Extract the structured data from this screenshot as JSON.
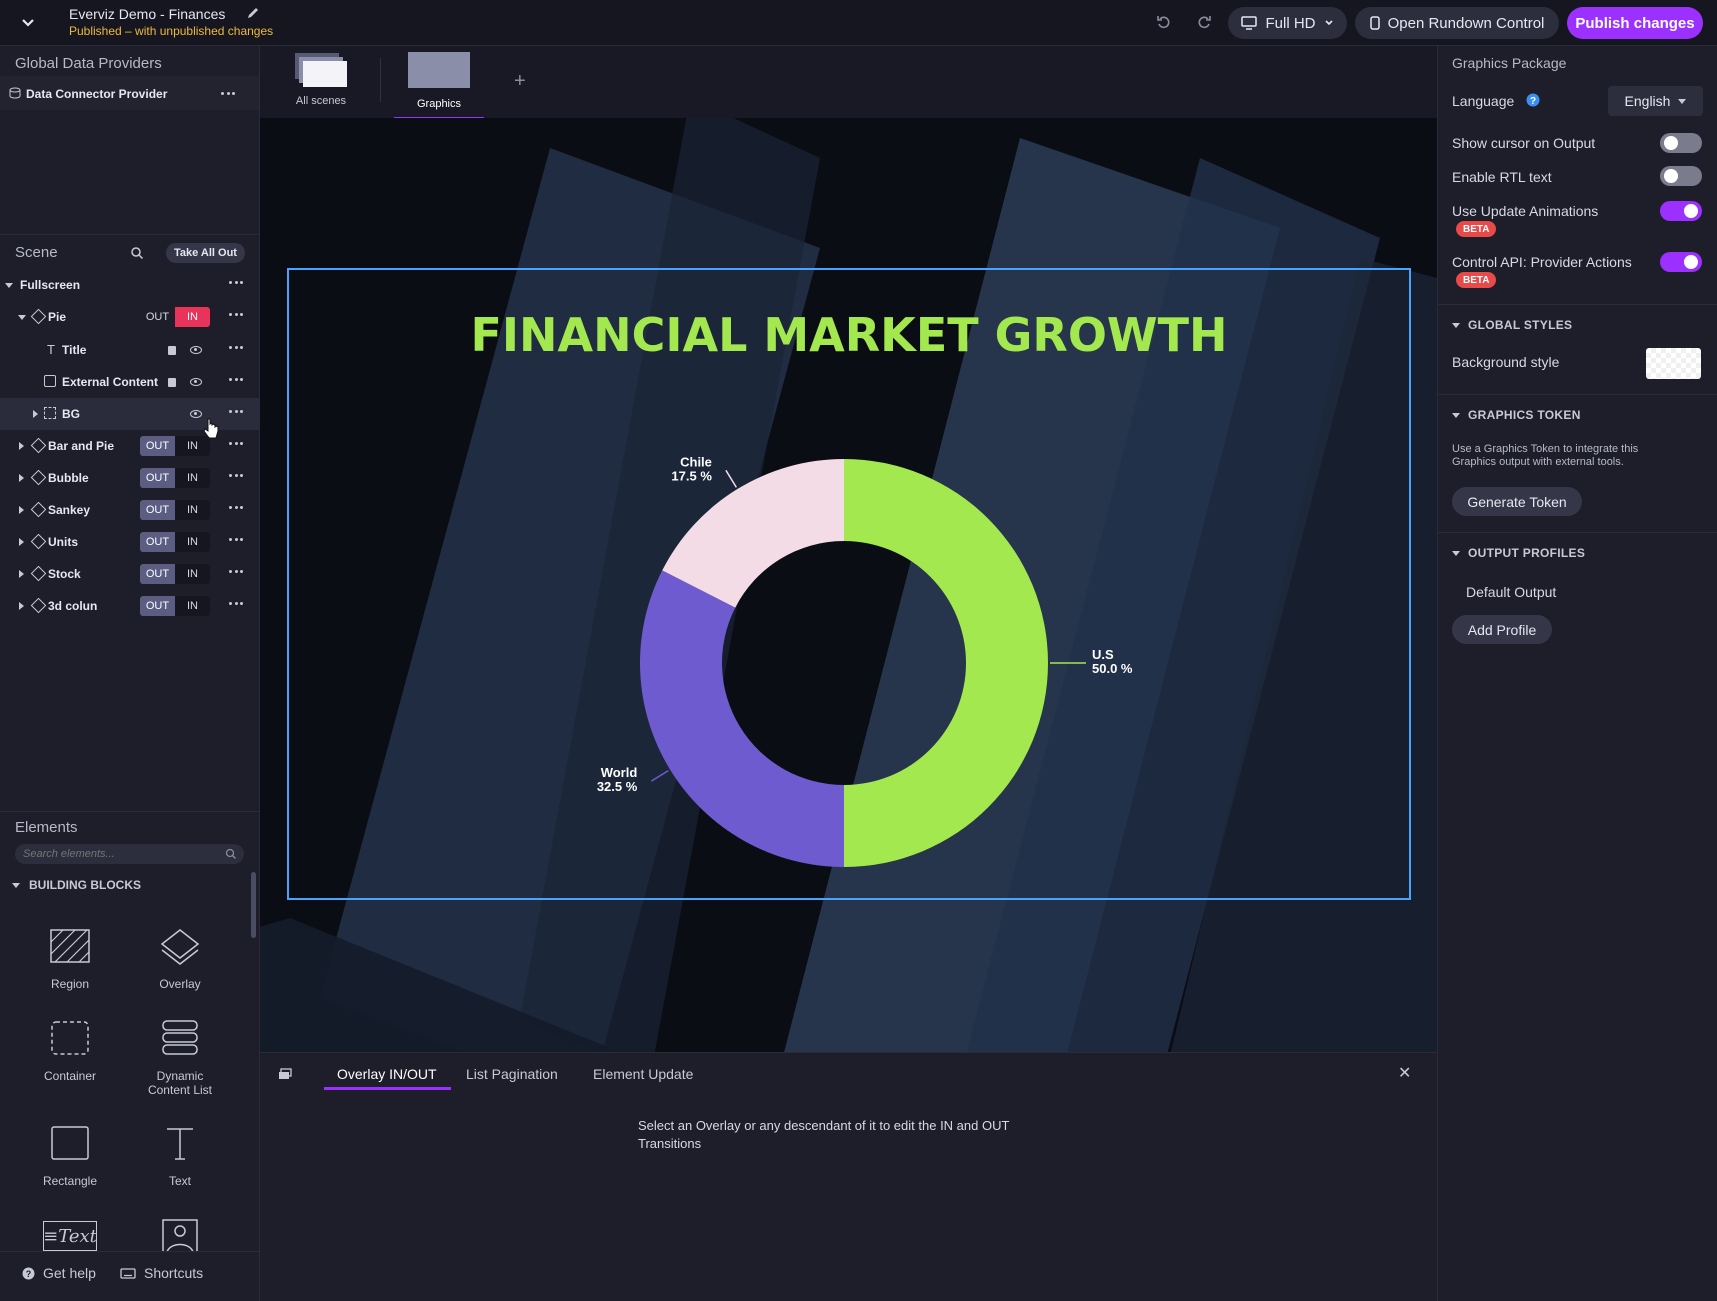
{
  "header": {
    "title": "Everviz Demo - Finances",
    "status": "Published – with unpublished changes",
    "resolution": "Full HD",
    "rundown_label": "Open Rundown Control",
    "publish_label": "Publish changes"
  },
  "left": {
    "providers_title": "Global Data Providers",
    "provider_name": "Data Connector Provider",
    "scene_title": "Scene",
    "take_all_out": "Take All Out",
    "fullscreen": "Fullscreen",
    "pie": "Pie",
    "title_item": "Title",
    "external_item": "External Content",
    "bg_item": "BG",
    "out": "OUT",
    "in": "IN",
    "scenes": [
      "Bar and Pie",
      "Bubble",
      "Sankey",
      "Units",
      "Stock",
      "3d colun"
    ],
    "elements_title": "Elements",
    "search_placeholder": "Search elements...",
    "building_blocks": "BUILDING BLOCKS",
    "blocks": {
      "region": "Region",
      "overlay": "Overlay",
      "container": "Container",
      "dynamic1": "Dynamic",
      "dynamic2": "Content List",
      "rectangle": "Rectangle",
      "text": "Text",
      "text_glyph": "≡Text"
    },
    "help": "Get help",
    "shortcuts": "Shortcuts"
  },
  "center": {
    "tabs": {
      "all": "All scenes",
      "graphics": "Graphics"
    },
    "chart_title": "FINANCIAL MARKET GROWTH",
    "bottom_tabs": [
      "Overlay IN/OUT",
      "List Pagination",
      "Element Update"
    ],
    "hint_line1": "Select an Overlay or any descendant of it to edit the IN and OUT",
    "hint_line2": "Transitions"
  },
  "chart_data": {
    "type": "pie",
    "title": "FINANCIAL MARKET GROWTH",
    "labels": [
      "U.S",
      "World",
      "Chile"
    ],
    "values": [
      50.0,
      32.5,
      17.5
    ],
    "value_labels": [
      "50.0 %",
      "32.5 %",
      "17.5 %"
    ],
    "colors": [
      "#a3e84f",
      "#6f5bd0",
      "#f4dce6"
    ],
    "donut": true
  },
  "right": {
    "package_title": "Graphics Package",
    "language_label": "Language",
    "language_value": "English",
    "show_cursor": "Show cursor on Output",
    "rtl": "Enable RTL text",
    "update_anim": "Use Update Animations",
    "control_api": "Control API: Provider Actions",
    "beta": "BETA",
    "global_styles": "GLOBAL STYLES",
    "bg_style": "Background style",
    "graphics_token": "GRAPHICS TOKEN",
    "token_desc1": "Use a Graphics Token to integrate this",
    "token_desc2": "Graphics output with external tools.",
    "generate_token": "Generate Token",
    "output_profiles": "OUTPUT PROFILES",
    "default_output": "Default Output",
    "add_profile": "Add Profile"
  },
  "colors": {
    "accent": "#9b30ff",
    "in_active": "#e8335a",
    "title_green": "#a3e84f",
    "out_active": "#5b5e82"
  }
}
